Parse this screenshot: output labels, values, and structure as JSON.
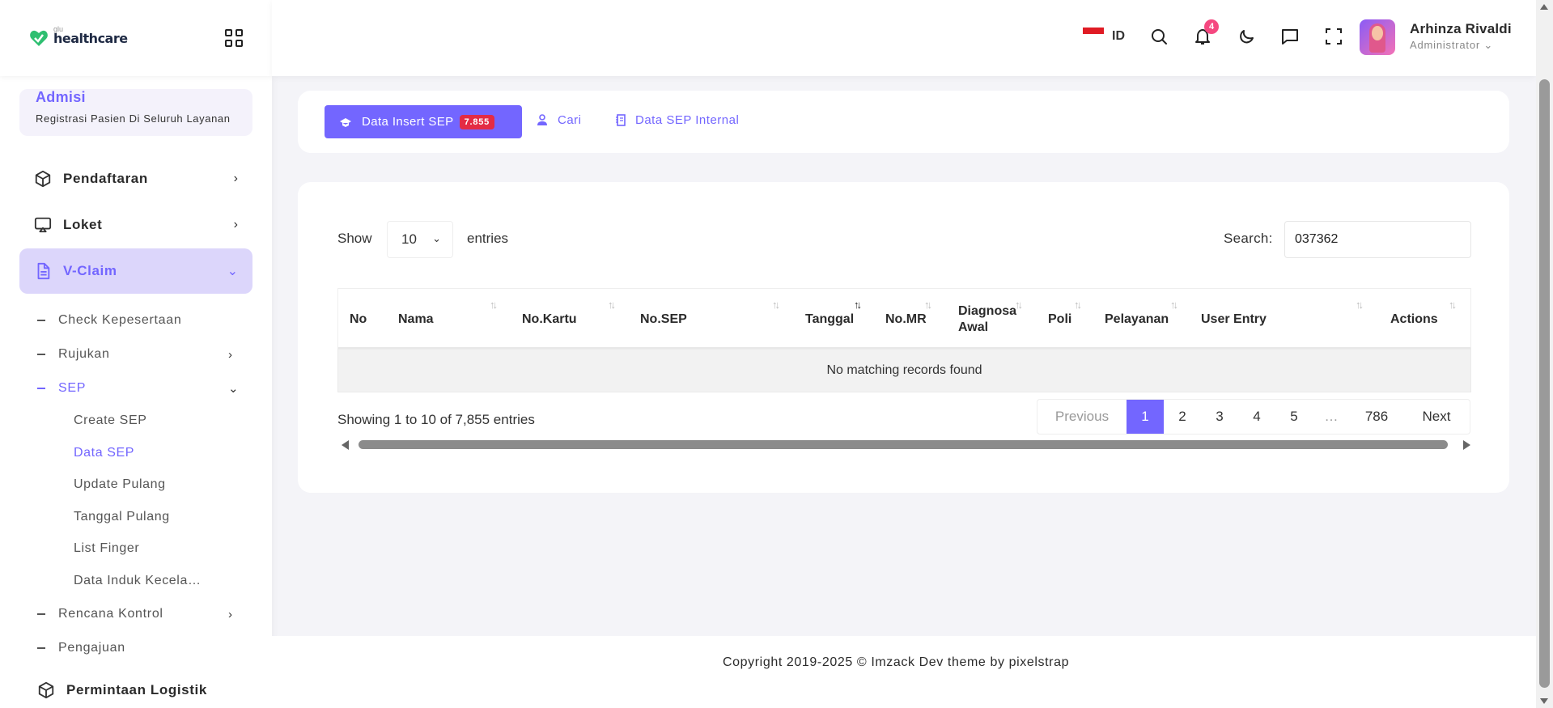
{
  "brand": {
    "small": "glu",
    "name": "healthcare"
  },
  "sidebar": {
    "section_title": "Admisi",
    "section_subtitle": "Registrasi Pasien Di Seluruh Layanan",
    "menu": [
      {
        "label": "Pendaftaran",
        "icon": "box-icon"
      },
      {
        "label": "Loket",
        "icon": "monitor-icon"
      },
      {
        "label": "V-Claim",
        "icon": "document-icon"
      }
    ],
    "vclaim_items": [
      {
        "label": "Check Kepesertaan"
      },
      {
        "label": "Rujukan"
      },
      {
        "label": "SEP"
      }
    ],
    "sep_items": [
      {
        "label": "Create SEP"
      },
      {
        "label": "Data SEP"
      },
      {
        "label": "Update Pulang"
      },
      {
        "label": "Tanggal Pulang"
      },
      {
        "label": "List Finger"
      },
      {
        "label": "Data Induk Kecela…"
      }
    ],
    "more_items": [
      {
        "label": "Rencana Kontrol"
      },
      {
        "label": "Pengajuan"
      }
    ],
    "bottom_item": {
      "label": "Permintaan Logistik",
      "icon": "box-icon"
    }
  },
  "header": {
    "lang": "ID",
    "notification_count": "4",
    "user_name": "Arhinza Rivaldi",
    "user_role": "Administrator"
  },
  "tabs": {
    "active": {
      "label": "Data Insert SEP",
      "count": "7.855"
    },
    "links": [
      {
        "label": "Cari"
      },
      {
        "label": "Data SEP Internal"
      }
    ]
  },
  "table": {
    "show_label": "Show",
    "page_size": "10",
    "entries_label": "entries",
    "search_label": "Search:",
    "search_value": "037362",
    "columns": [
      "No",
      "Nama",
      "No.Kartu",
      "No.SEP",
      "Tanggal",
      "No.MR",
      "Diagnosa Awal",
      "Poli",
      "Pelayanan",
      "User Entry",
      "Actions"
    ],
    "empty_message": "No matching records found",
    "info": "Showing 1 to 10 of 7,855 entries",
    "pagination": [
      "Previous",
      "1",
      "2",
      "3",
      "4",
      "5",
      "…",
      "786",
      "Next"
    ]
  },
  "footer": {
    "text": "Copyright 2019-2025 © Imzack Dev theme by pixelstrap"
  },
  "colors": {
    "accent": "#7366ff",
    "badge": "#e42b44",
    "notif": "#f54880"
  }
}
